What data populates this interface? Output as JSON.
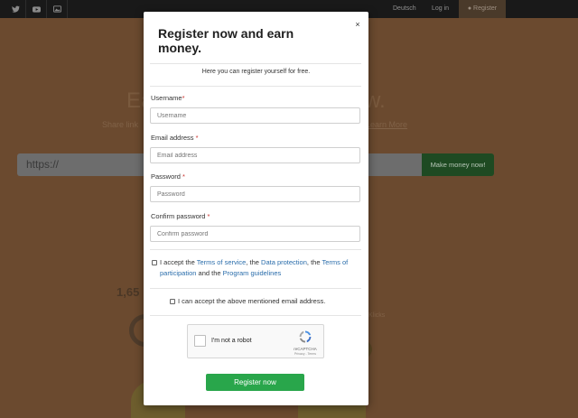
{
  "nav": {
    "social_icons": [
      "twitter-icon",
      "youtube-icon",
      "image-icon"
    ],
    "language": "Deutsch",
    "login": "Log in",
    "register": "Register"
  },
  "hero": {
    "title_left": "Ea",
    "title_right": "w.",
    "subtitle": "Share link",
    "learn_more": "Learn More",
    "url_value": "https://",
    "cta": "Make money now!",
    "stat_value": "1,65",
    "stat_label": "Klicks"
  },
  "modal": {
    "title": "Register now and earn money.",
    "close": "×",
    "intro": "Here you can register yourself for free.",
    "fields": [
      {
        "label": "Username",
        "required_mark": "*",
        "placeholder": "Username"
      },
      {
        "label": "Email address",
        "required_mark": "*",
        "placeholder": "Email address"
      },
      {
        "label": "Password",
        "required_mark": "*",
        "placeholder": "Password"
      },
      {
        "label": "Confirm password",
        "required_mark": "*",
        "placeholder": "Confirm password"
      }
    ],
    "terms": {
      "prefix": "I accept the ",
      "tos": "Terms of service",
      "sep1": ", the ",
      "data": "Data protection",
      "sep2": ", the ",
      "participation": "Terms of participation",
      "sep3": " and the ",
      "guidelines": "Program guidelines"
    },
    "email_consent": "I can accept the above mentioned email address.",
    "captcha": {
      "label": "I'm not a robot",
      "brand": "reCAPTCHA",
      "fine": "Privacy - Terms"
    },
    "submit": "Register now"
  },
  "colors": {
    "topbar": "#191919",
    "overlay_bg": "#6b4a2f",
    "submit": "#29a64b",
    "link": "#2a6dab",
    "required": "#c9302c"
  }
}
